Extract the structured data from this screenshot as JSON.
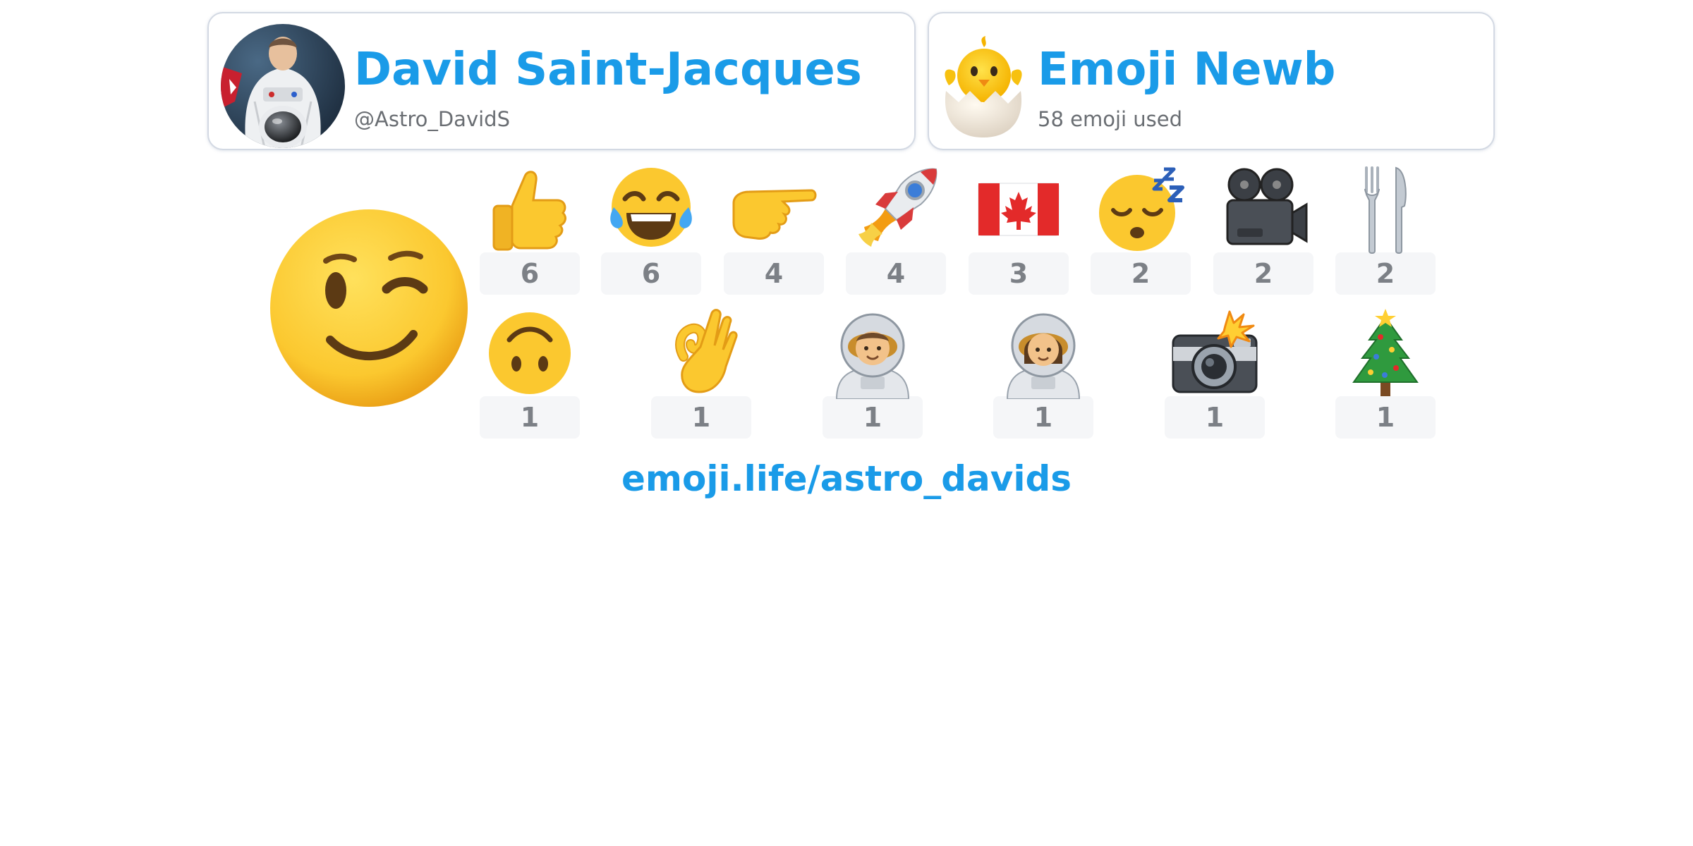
{
  "profile": {
    "name": "David Saint-Jacques",
    "handle": "@Astro_DavidS",
    "avatar": "astronaut-avatar"
  },
  "rank": {
    "title": "Emoji Newb",
    "subtitle": "58 emoji used",
    "icon": "hatching-chick-icon"
  },
  "favorite_emoji": {
    "icon": "winking-face-icon"
  },
  "emoji_counts": [
    {
      "icon": "thumbs-up-icon",
      "count": "6"
    },
    {
      "icon": "tears-of-joy-icon",
      "count": "6"
    },
    {
      "icon": "pointing-right-icon",
      "count": "4"
    },
    {
      "icon": "rocket-icon",
      "count": "4"
    },
    {
      "icon": "canada-flag-icon",
      "count": "3"
    },
    {
      "icon": "sleeping-face-icon",
      "count": "2"
    },
    {
      "icon": "movie-camera-icon",
      "count": "2"
    },
    {
      "icon": "fork-and-knife-icon",
      "count": "2"
    },
    {
      "icon": "upside-down-face-icon",
      "count": "1"
    },
    {
      "icon": "ok-hand-icon",
      "count": "1"
    },
    {
      "icon": "man-astronaut-icon",
      "count": "1"
    },
    {
      "icon": "woman-astronaut-icon",
      "count": "1"
    },
    {
      "icon": "camera-with-flash-icon",
      "count": "1"
    },
    {
      "icon": "christmas-tree-icon",
      "count": "1"
    }
  ],
  "link": {
    "text": "emoji.life/astro_davids"
  },
  "colors": {
    "accent": "#1a9be8",
    "muted_text": "#6a6e73",
    "count_text": "#7c8086",
    "count_bg": "#f5f6f8",
    "card_border": "#d3d9e3",
    "emoji_yellow": "#fbc82f"
  }
}
